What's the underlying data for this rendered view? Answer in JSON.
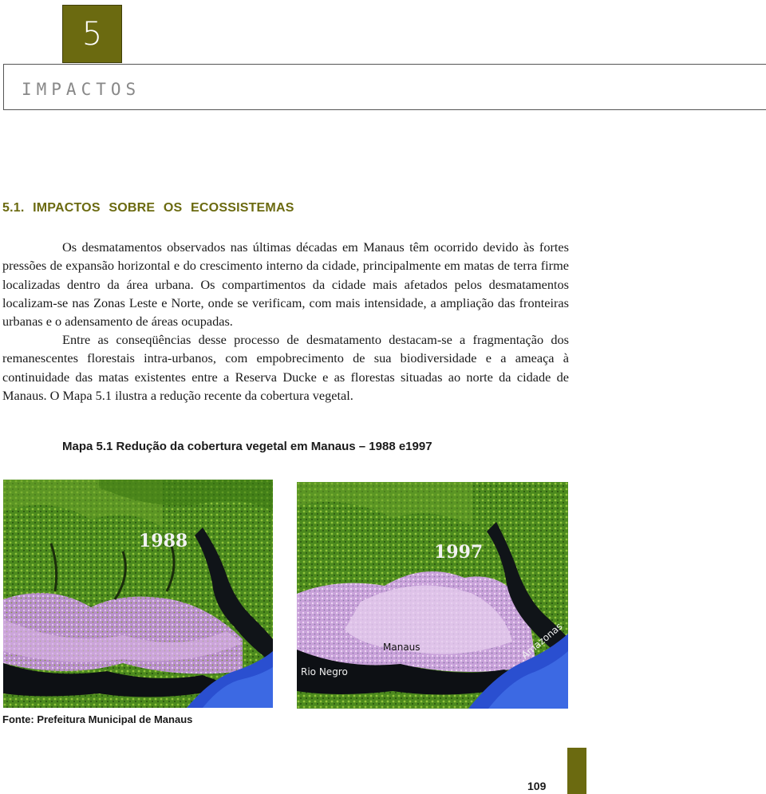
{
  "chapter": {
    "number": "5",
    "title": "IMPACTOS"
  },
  "section": {
    "heading": "5.1.  IMPACTOS SOBRE OS ECOSSISTEMAS"
  },
  "paragraphs": [
    "Os desmatamentos observados nas últimas décadas em Manaus têm ocorrido devido às fortes pressões de expansão horizontal e do crescimento interno da cidade, principalmente em matas de terra firme localizadas dentro da área urbana. Os compartimentos da cidade mais afetados pelos desmatamentos localizam-se nas Zonas Leste e Norte, onde se verificam, com mais intensidade, a ampliação das fronteiras urbanas e o adensamento de áreas ocupadas.",
    "Entre as conseqüências desse processo de desmatamento destacam-se a fragmentação dos remanescentes florestais intra-urbanos, com empobrecimento de sua biodiversidade e a ameaça à continuidade das matas existentes entre a Reserva Ducke e as florestas situadas ao norte da cidade de Manaus. O Mapa 5.1 ilustra a redução recente da cobertura vegetal."
  ],
  "map": {
    "caption": "Mapa 5.1 Redução da cobertura vegetal em Manaus – 1988 e1997",
    "panels": [
      {
        "year": "1988"
      },
      {
        "year": "1997",
        "labels": [
          "Manaus",
          "Rio Negro",
          "Amazonas"
        ]
      }
    ],
    "source": "Fonte: Prefeitura Municipal de Manaus"
  },
  "page_number": "109",
  "colors": {
    "accent": "#6b6a10",
    "forest": "#3f7a1a",
    "urban": "#c79fd6",
    "river": "#101418",
    "water_blue": "#2a4fd0"
  }
}
